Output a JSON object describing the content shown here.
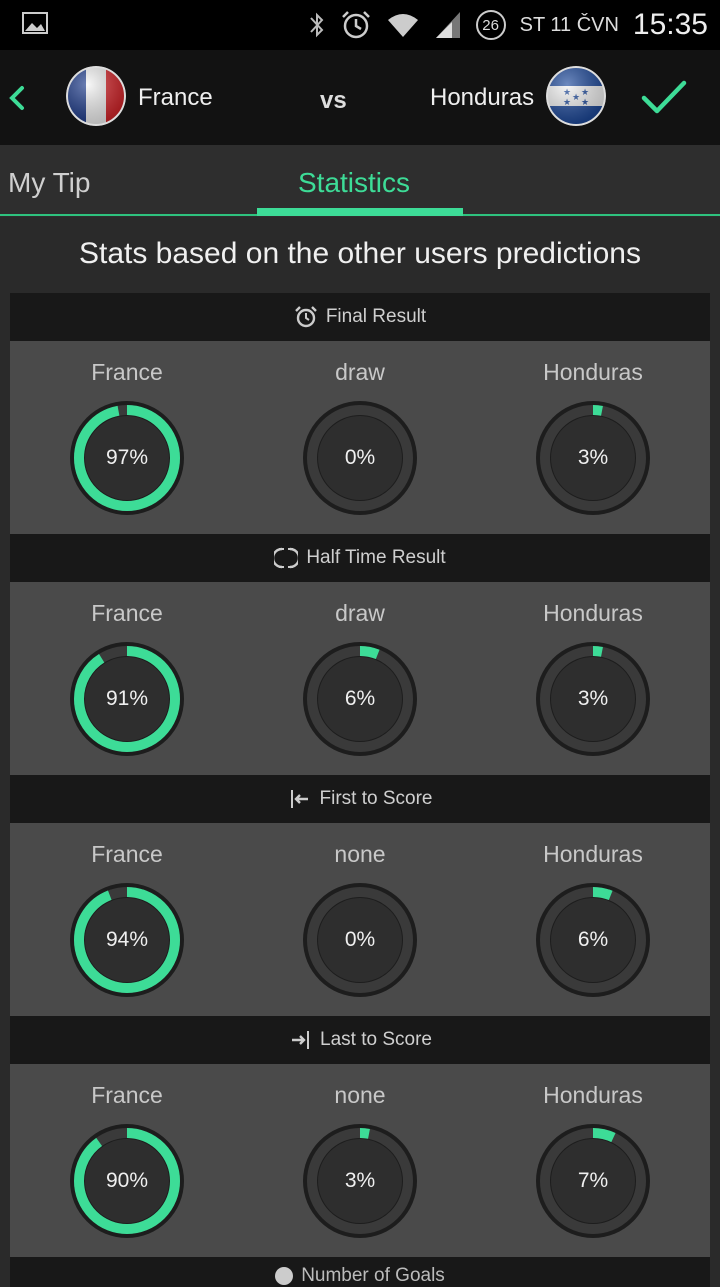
{
  "statusbar": {
    "badge": "26",
    "date": "ST 11 ČVN",
    "time": "15:35"
  },
  "header": {
    "home_team": "France",
    "away_team": "Honduras",
    "vs": "vs"
  },
  "tabs": [
    {
      "label": "My Tip",
      "active": false
    },
    {
      "label": "Statistics",
      "active": true
    }
  ],
  "subtitle": "Stats based on the other users predictions",
  "colors": {
    "accent": "#3ddc97",
    "ring_track": "#1f1f1f",
    "ring_bg": "#2b2b2b"
  },
  "sections": [
    {
      "title": "Final Result",
      "icon": "alarm-clock-icon",
      "items": [
        {
          "label": "France",
          "value": "97%",
          "fraction": 0.97
        },
        {
          "label": "draw",
          "value": "0%",
          "fraction": 0.0
        },
        {
          "label": "Honduras",
          "value": "3%",
          "fraction": 0.03
        }
      ]
    },
    {
      "title": "Half Time Result",
      "icon": "half-time-icon",
      "items": [
        {
          "label": "France",
          "value": "91%",
          "fraction": 0.91
        },
        {
          "label": "draw",
          "value": "6%",
          "fraction": 0.06
        },
        {
          "label": "Honduras",
          "value": "3%",
          "fraction": 0.03
        }
      ]
    },
    {
      "title": "First to Score",
      "icon": "first-to-score-icon",
      "items": [
        {
          "label": "France",
          "value": "94%",
          "fraction": 0.94
        },
        {
          "label": "none",
          "value": "0%",
          "fraction": 0.0
        },
        {
          "label": "Honduras",
          "value": "6%",
          "fraction": 0.06
        }
      ]
    },
    {
      "title": "Last to Score",
      "icon": "last-to-score-icon",
      "items": [
        {
          "label": "France",
          "value": "90%",
          "fraction": 0.9
        },
        {
          "label": "none",
          "value": "3%",
          "fraction": 0.03
        },
        {
          "label": "Honduras",
          "value": "7%",
          "fraction": 0.07
        }
      ]
    }
  ],
  "next_section": {
    "title": "Number of Goals",
    "icon": "ball-icon"
  }
}
